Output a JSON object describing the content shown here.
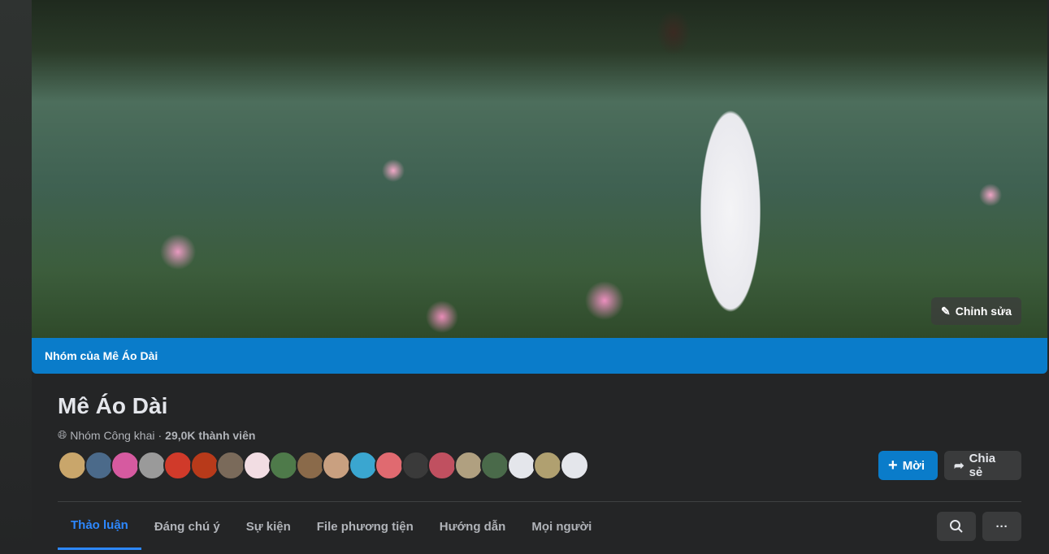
{
  "cover": {
    "edit_label": "Chỉnh sửa"
  },
  "group_bar": {
    "label": "Nhóm của Mê Áo Dài"
  },
  "group": {
    "name": "Mê Áo Dài",
    "privacy": "Nhóm Công khai",
    "separator": " · ",
    "members": "29,0K thành viên"
  },
  "member_avatars": [
    "#c9a66b",
    "#4b6a8a",
    "#d65aa0",
    "#9a9a9a",
    "#d03a2a",
    "#b83a1a",
    "#7a6a5a",
    "#f2dde3",
    "#4e7a4a",
    "#8a6a4a",
    "#c9a080",
    "#3aa6d0",
    "#e06a70",
    "#3a3a3a",
    "#c05060",
    "#b0a080",
    "#4a6a4a",
    "#e4e6eb",
    "#b0a070",
    "#e4e6eb"
  ],
  "actions": {
    "invite": "Mời",
    "share": "Chia sẻ"
  },
  "tabs": [
    "Thảo luận",
    "Đáng chú ý",
    "Sự kiện",
    "File phương tiện",
    "Hướng dẫn",
    "Mọi người"
  ],
  "more_label": "···"
}
